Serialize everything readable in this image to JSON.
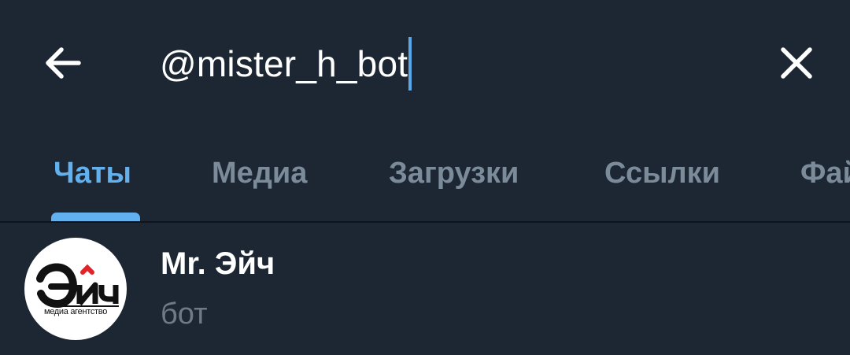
{
  "header": {
    "back_icon": "arrow-left-icon",
    "search_query": "@mister_h_bot",
    "clear_icon": "close-icon"
  },
  "tabs": [
    {
      "label": "Чаты",
      "active": true
    },
    {
      "label": "Медиа",
      "active": false
    },
    {
      "label": "Загрузки",
      "active": false
    },
    {
      "label": "Ссылки",
      "active": false
    },
    {
      "label": "Фай",
      "active": false
    }
  ],
  "colors": {
    "background": "#1d2733",
    "accent": "#62b0ee",
    "inactive_tab": "#7c8b99",
    "secondary_text": "#6e7b87"
  },
  "results": [
    {
      "name": "Mr. Эйч",
      "status": "бот",
      "avatar": {
        "logo_text": "Эич",
        "subtitle": "медиа агентство"
      }
    }
  ]
}
